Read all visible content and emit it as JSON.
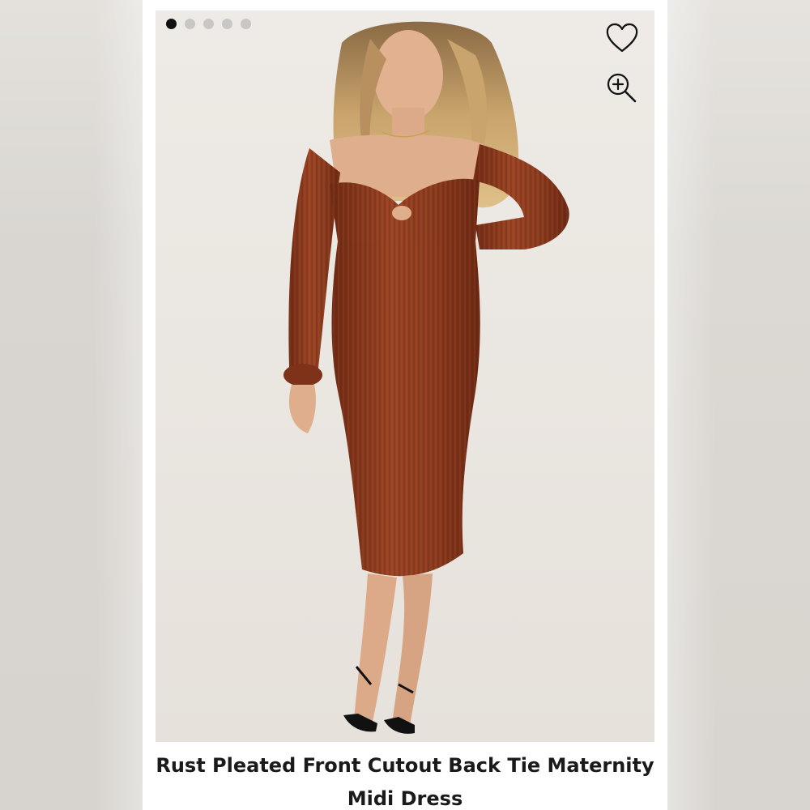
{
  "product": {
    "title": "Rust Pleated Front Cutout Back Tie Maternity Midi Dress",
    "image_alt": "Model wearing rust pleated long-sleeve midi dress with front knot cutout"
  },
  "carousel": {
    "total_slides": 5,
    "active_index": 0
  },
  "icons": {
    "favorite": "heart-icon",
    "zoom": "zoom-in-icon"
  },
  "colors": {
    "dress": "#8a3a1e",
    "background": "#ece8e3",
    "active_dot": "#111111",
    "inactive_dot": "#c9c7c5"
  }
}
